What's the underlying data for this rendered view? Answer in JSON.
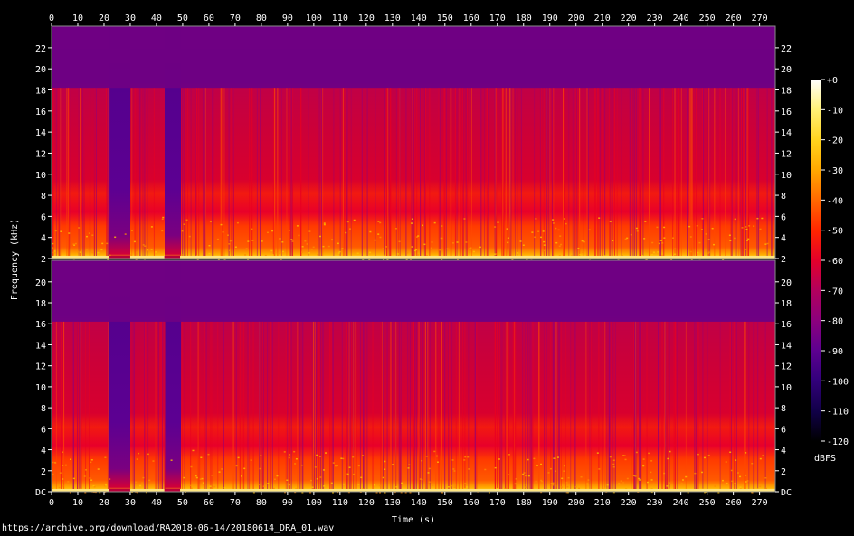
{
  "source_url": "https://archive.org/download/RA2018-06-14/20180614_DRA_01.wav",
  "chart_data": {
    "type": "heatmap",
    "subtype": "spectrogram",
    "channels": 2,
    "xlabel": "Time (s)",
    "ylabel": "Frequency (kHz)",
    "x_range": [
      0,
      276
    ],
    "x_ticks": [
      0,
      10,
      20,
      30,
      40,
      50,
      60,
      70,
      80,
      90,
      100,
      110,
      120,
      130,
      140,
      150,
      160,
      170,
      180,
      190,
      200,
      210,
      220,
      230,
      240,
      250,
      260,
      270
    ],
    "y_range_khz": [
      0,
      22.05
    ],
    "y_ticks_top": [
      "2",
      "4",
      "6",
      "8",
      "10",
      "12",
      "14",
      "16",
      "18",
      "20",
      "22"
    ],
    "y_ticks_bottom": [
      "DC",
      "2",
      "4",
      "6",
      "8",
      "10",
      "12",
      "14",
      "16",
      "18",
      "20"
    ],
    "y_tick_values": [
      0,
      2,
      4,
      6,
      8,
      10,
      12,
      14,
      16,
      18,
      20,
      22
    ],
    "colorbar": {
      "label": "dBFS",
      "ticks": [
        "+0",
        "-10",
        "-20",
        "-30",
        "-40",
        "-50",
        "-60",
        "-70",
        "-80",
        "-90",
        "-100",
        "-110",
        "-120"
      ],
      "range": [
        0,
        -120
      ],
      "colors": [
        "#ffffff",
        "#fff27a",
        "#ffd21c",
        "#ffa800",
        "#ff6b00",
        "#ff2400",
        "#e3002a",
        "#b4005b",
        "#8a007e",
        "#5d0090",
        "#33007c",
        "#100046",
        "#000000"
      ]
    },
    "features": {
      "lowpass_cutoff_khz": 16.2,
      "quiet_intervals_s": [
        [
          22,
          30
        ],
        [
          43,
          49
        ]
      ],
      "active_intervals_s": [
        [
          0,
          22
        ],
        [
          30,
          43
        ],
        [
          49,
          276
        ]
      ],
      "broadband_bands_khz": [
        [
          0,
          3.5
        ],
        [
          5.5,
          7.5
        ]
      ]
    }
  }
}
